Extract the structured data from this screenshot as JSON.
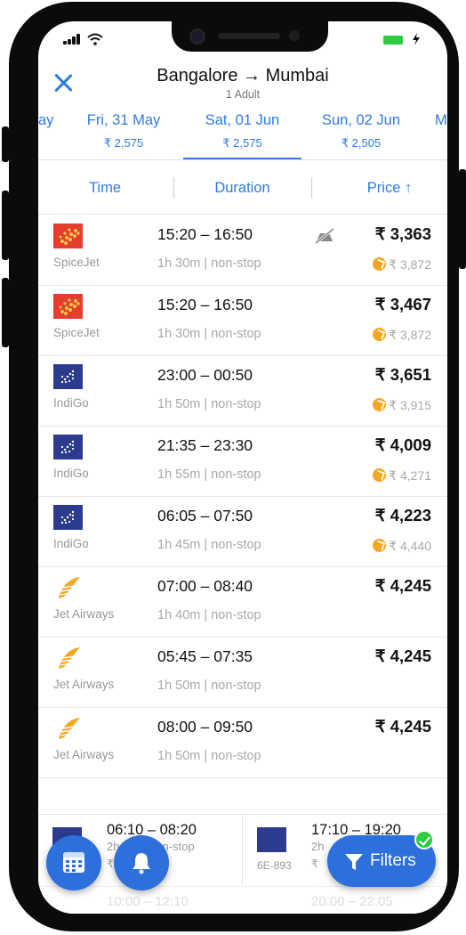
{
  "header": {
    "title": "Bangalore → Mumbai",
    "subtitle": "1 Adult"
  },
  "dates": {
    "prev_partial": "ay",
    "next_partial": "M",
    "tabs": [
      {
        "date": "Fri, 31 May",
        "price": "₹ 2,575",
        "active": false
      },
      {
        "date": "Sat, 01 Jun",
        "price": "₹ 2,575",
        "active": true
      },
      {
        "date": "Sun, 02 Jun",
        "price": "₹ 2,505",
        "active": false
      }
    ]
  },
  "sort": {
    "time": "Time",
    "duration": "Duration",
    "price": "Price ↑"
  },
  "flights": [
    {
      "airline": "SpiceJet",
      "logo": "spicejet-logo",
      "times": "15:20 – 16:50",
      "duration": "1h 30m  | non-stop",
      "price": "₹ 3,363",
      "old_price": "₹ 3,872",
      "no_meal": true
    },
    {
      "airline": "SpiceJet",
      "logo": "spicejet-logo",
      "times": "15:20 – 16:50",
      "duration": "1h 30m  | non-stop",
      "price": "₹ 3,467",
      "old_price": "₹ 3,872",
      "no_meal": false
    },
    {
      "airline": "IndiGo",
      "logo": "indigo-logo",
      "times": "23:00 – 00:50",
      "duration": "1h 50m  | non-stop",
      "price": "₹ 3,651",
      "old_price": "₹ 3,915",
      "no_meal": false
    },
    {
      "airline": "IndiGo",
      "logo": "indigo-logo",
      "times": "21:35 – 23:30",
      "duration": "1h 55m  | non-stop",
      "price": "₹ 4,009",
      "old_price": "₹ 4,271",
      "no_meal": false
    },
    {
      "airline": "IndiGo",
      "logo": "indigo-logo",
      "times": "06:05 – 07:50",
      "duration": "1h 45m  | non-stop",
      "price": "₹ 4,223",
      "old_price": "₹ 4,440",
      "no_meal": false
    },
    {
      "airline": "Jet Airways",
      "logo": "jet-airways-logo",
      "times": "07:00 – 08:40",
      "duration": "1h 40m  | non-stop",
      "price": "₹ 4,245",
      "old_price": "",
      "no_meal": false
    },
    {
      "airline": "Jet Airways",
      "logo": "jet-airways-logo",
      "times": "05:45 – 07:35",
      "duration": "1h 50m  | non-stop",
      "price": "₹ 4,245",
      "old_price": "",
      "no_meal": false
    },
    {
      "airline": "Jet Airways",
      "logo": "jet-airways-logo",
      "times": "08:00 – 09:50",
      "duration": "1h 50m  | non-stop",
      "price": "₹ 4,245",
      "old_price": "",
      "no_meal": false
    }
  ],
  "bottom_cards": [
    {
      "times": "06:10 – 08:20",
      "duration": "2h",
      "duration_tail": "non-stop",
      "code": "",
      "price": "₹"
    },
    {
      "times": "17:10 – 19:20",
      "duration": "2h",
      "duration_tail": "",
      "code": "6E-893",
      "price": "₹"
    }
  ],
  "ghost_row": {
    "left": "10:00 – 12:10",
    "right": "20:00 – 22:05"
  },
  "actions": {
    "filters_label": "Filters"
  },
  "colors": {
    "accent": "#2d7be5",
    "fab": "#2d6fdb",
    "spicejet": "#e53d2e",
    "indigo": "#2d3b8e",
    "jet": "#f5a623",
    "success": "#2ecc40"
  }
}
